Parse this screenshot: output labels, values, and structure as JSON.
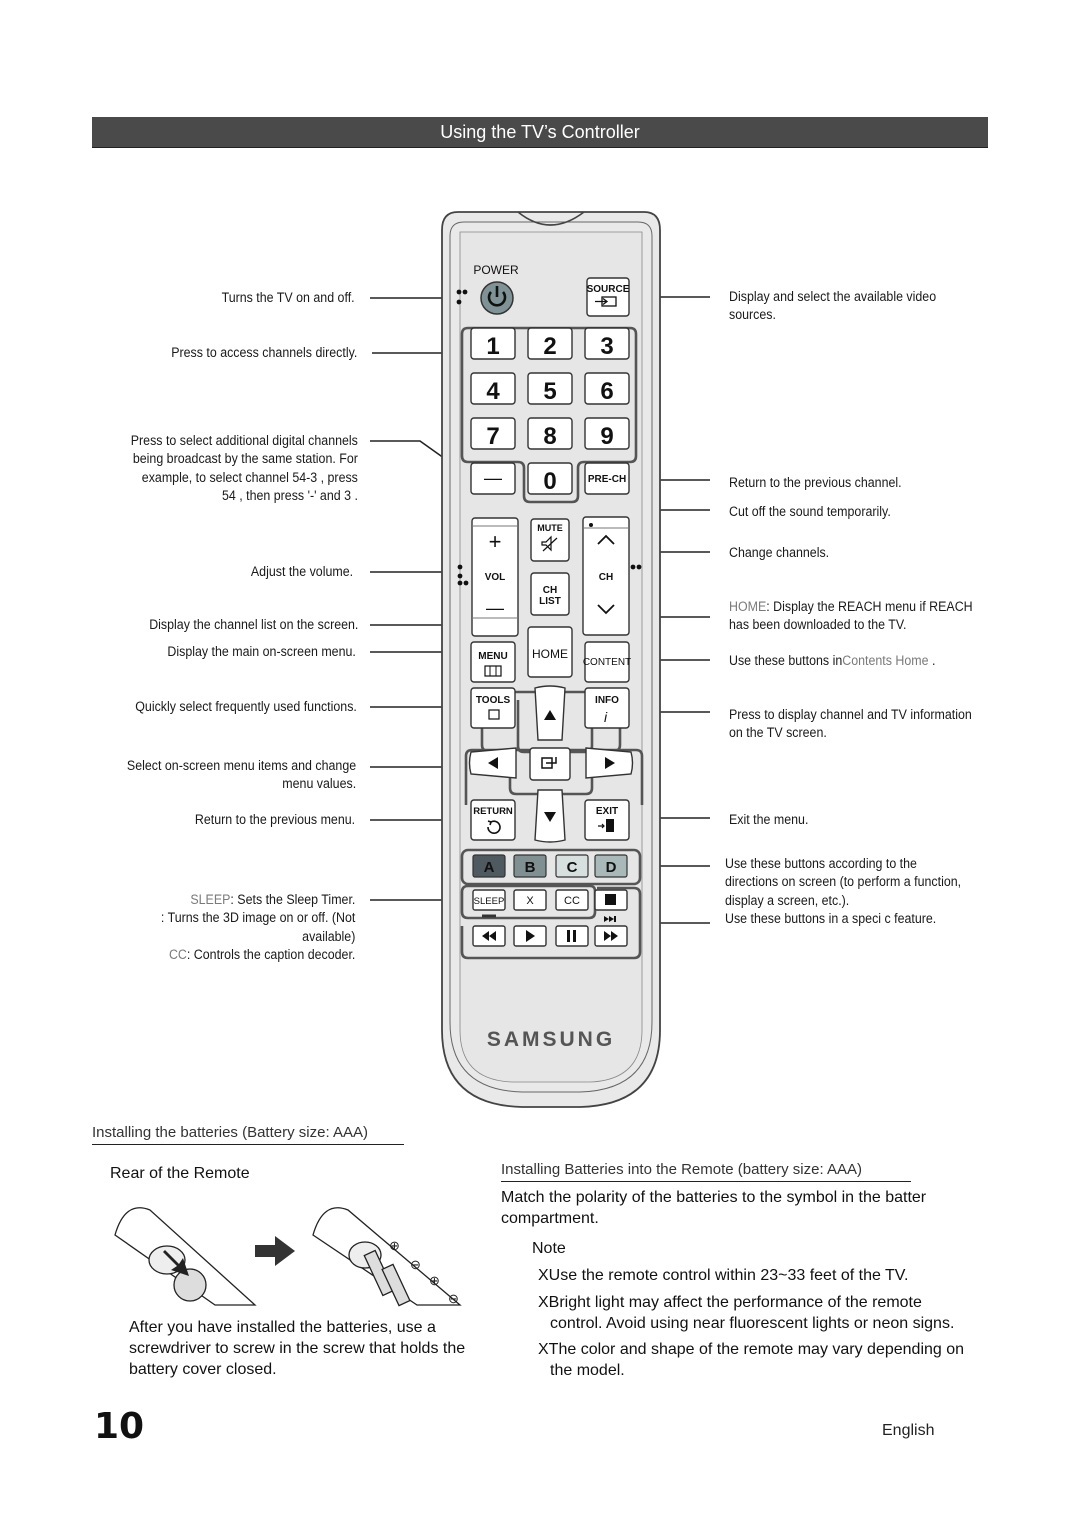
{
  "header": {
    "title": "Using the TV’s Controller"
  },
  "remote": {
    "power_label": "POWER",
    "source_label": "SOURCE",
    "digits": [
      "1",
      "2",
      "3",
      "4",
      "5",
      "6",
      "7",
      "8",
      "9"
    ],
    "dash_label": "—",
    "zero_label": "0",
    "prech_label": "PRE-CH",
    "mute_label": "MUTE",
    "vol_label": "VOL",
    "vol_plus": "+",
    "vol_minus": "—",
    "ch_label": "CH",
    "chlist_label_1": "CH",
    "chlist_label_2": "LIST",
    "menu_label": "MENU",
    "home_label": "HOME",
    "content_label": "CONTENT",
    "tools_label": "TOOLS",
    "info_label": "INFO",
    "return_label": "RETURN",
    "exit_label": "EXIT",
    "color_buttons": [
      {
        "label": "A",
        "color": "#4f5a60"
      },
      {
        "label": "B",
        "color": "#7f8f92"
      },
      {
        "label": "C",
        "color": "#d7dfdf"
      },
      {
        "label": "D",
        "color": "#a9b8b8"
      }
    ],
    "sleep_label": "SLEEP",
    "x_label": "X",
    "cc_label": "CC",
    "brand": "SAMSUNG"
  },
  "left_callouts": {
    "power": "Turns the TV on and off.",
    "digits": "Press to access channels directly.",
    "dash": [
      "Press to select additional digital channels",
      "being broadcast by the same station. For",
      "example, to select channel  54-3 , press",
      "54 , then press '-' and  3 ."
    ],
    "volume": "Adjust the volume.",
    "chlist": "Display the channel list on the screen.",
    "menu": "Display the main on-screen menu.",
    "tools": "Quickly select frequently used functions.",
    "nav": [
      "Select on-screen menu items and change",
      "menu values."
    ],
    "return": "Return to the previous menu.",
    "sleep_key": "SLEEP",
    "sleep_desc": ": Sets the Sleep Timer.",
    "x_desc": [
      ": Turns the 3D image on or off. (Not",
      "available)"
    ],
    "cc_key": "CC",
    "cc_desc": ": Controls the caption decoder."
  },
  "right_callouts": {
    "source": [
      "Display and select the available video",
      "sources."
    ],
    "prech": "Return to the previous channel.",
    "mute": "Cut off the sound temporarily.",
    "ch": "Change channels.",
    "home_key": "HOME",
    "home_desc": ": Display the REACH menu if REACH",
    "home_desc2": "has been downloaded to the TV.",
    "content_pre": "Use these buttons in",
    "content_key": "Contents Home",
    "content_post": " .",
    "info": [
      "Press to display channel and TV information",
      "on the TV screen."
    ],
    "exit": "Exit the menu.",
    "color": [
      "Use these buttons according to the",
      "directions on screen (to perform a function,",
      "display a screen, etc.)."
    ],
    "playback": "Use these buttons in a speci c feature."
  },
  "batteries": {
    "section_title": "Installing the batteries (Battery size: AAA)",
    "rear_title": "Rear of the Remote",
    "after_text": [
      "After you have installed the batteries, use a",
      "screwdriver to screw in the screw that holds the",
      "battery cover closed."
    ],
    "right_title": "Installing Batteries into the Remote (battery size: AAA)",
    "polarity": [
      "Match the polarity of the batteries to the symbol in the batter",
      "compartment."
    ],
    "note_label": "Note",
    "bullet": "X",
    "notes": [
      [
        "Use the remote control within 23~33 feet of the TV."
      ],
      [
        "Bright light may affect the performance of the remote",
        "control. Avoid using near fluorescent lights or neon signs."
      ],
      [
        "The color and shape of the remote may vary depending on",
        "the model."
      ]
    ],
    "plus": "⊕",
    "minus": "⊖"
  },
  "footer": {
    "page_number": "10",
    "language": "English"
  }
}
